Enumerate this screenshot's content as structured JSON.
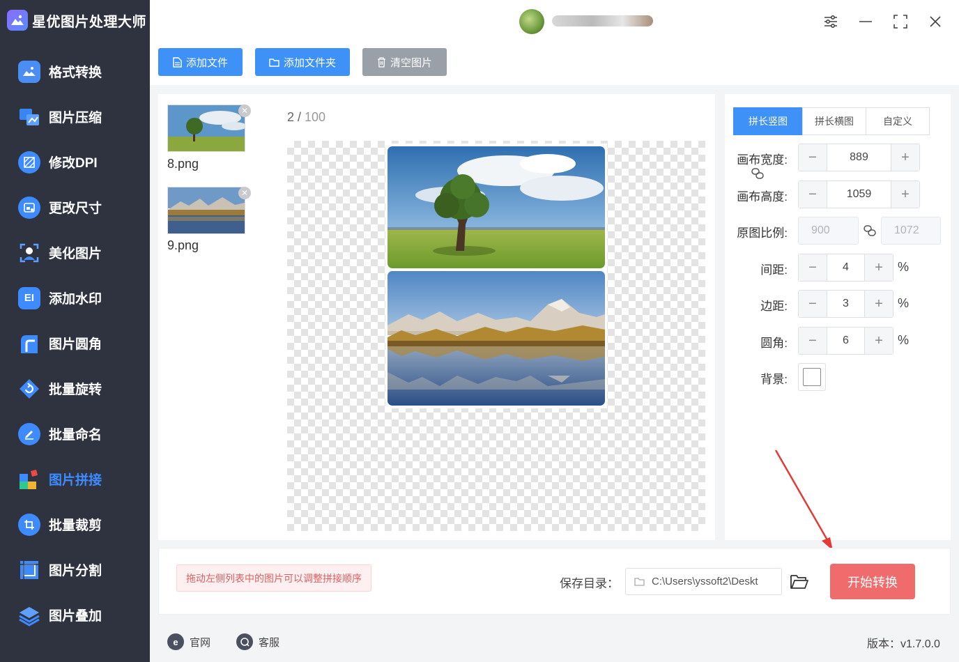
{
  "app": {
    "title": "星优图片处理大师",
    "version_label": "版本：v1.7.0.0"
  },
  "sidebar": {
    "items": [
      {
        "label": "格式转换",
        "icon": "image-convert-icon",
        "color": "#4a8ef5"
      },
      {
        "label": "图片压缩",
        "icon": "image-compress-icon",
        "color": "#3a86f0"
      },
      {
        "label": "修改DPI",
        "icon": "dpi-icon",
        "color": "#3d8bff"
      },
      {
        "label": "更改尺寸",
        "icon": "resize-icon",
        "color": "#3d8bff"
      },
      {
        "label": "美化图片",
        "icon": "beautify-icon",
        "color": "#3d8bff"
      },
      {
        "label": "添加水印",
        "icon": "watermark-icon",
        "color": "#3d8bff"
      },
      {
        "label": "图片圆角",
        "icon": "rounded-corner-icon",
        "color": "#3d8bff"
      },
      {
        "label": "批量旋转",
        "icon": "rotate-icon",
        "color": "#3d8bff"
      },
      {
        "label": "批量命名",
        "icon": "rename-icon",
        "color": "#3d8bff"
      },
      {
        "label": "图片拼接",
        "icon": "puzzle-icon",
        "color": "#3d8bff",
        "active": true
      },
      {
        "label": "批量裁剪",
        "icon": "crop-icon",
        "color": "#3d8bff"
      },
      {
        "label": "图片分割",
        "icon": "split-icon",
        "color": "#3d8bff"
      },
      {
        "label": "图片叠加",
        "icon": "layers-icon",
        "color": "#3d8bff"
      }
    ]
  },
  "toolbar": {
    "add_file": "添加文件",
    "add_folder": "添加文件夹",
    "clear_images": "清空图片"
  },
  "files": [
    {
      "name": "8.png"
    },
    {
      "name": "9.png"
    }
  ],
  "preview": {
    "current": "2",
    "separator": " / ",
    "total": "100"
  },
  "settings": {
    "tabs": [
      "拼长竖图",
      "拼长横图",
      "自定义"
    ],
    "active_tab": 0,
    "canvas_width_label": "画布宽度:",
    "canvas_width": "889",
    "canvas_height_label": "画布高度:",
    "canvas_height": "1059",
    "ratio_label": "原图比例:",
    "ratio_w": "900",
    "ratio_h": "1072",
    "spacing_label": "间距:",
    "spacing": "4",
    "margin_label": "边距:",
    "margin": "3",
    "radius_label": "圆角:",
    "radius": "6",
    "unit": "%",
    "background_label": "背景:",
    "minus": "−",
    "plus": "+"
  },
  "bottom": {
    "hint": "拖动左侧列表中的图片可以调整拼接顺序",
    "save_label": "保存目录：",
    "save_path": "C:\\Users\\yssoft2\\Deskt",
    "start_button": "开始转换"
  },
  "footer": {
    "website": "官网",
    "support": "客服"
  },
  "colors": {
    "sidebar_bg": "#2f3340",
    "primary": "#3e92f7",
    "start_button": "#f06b6b",
    "annotation_arrow": "#e53935"
  }
}
